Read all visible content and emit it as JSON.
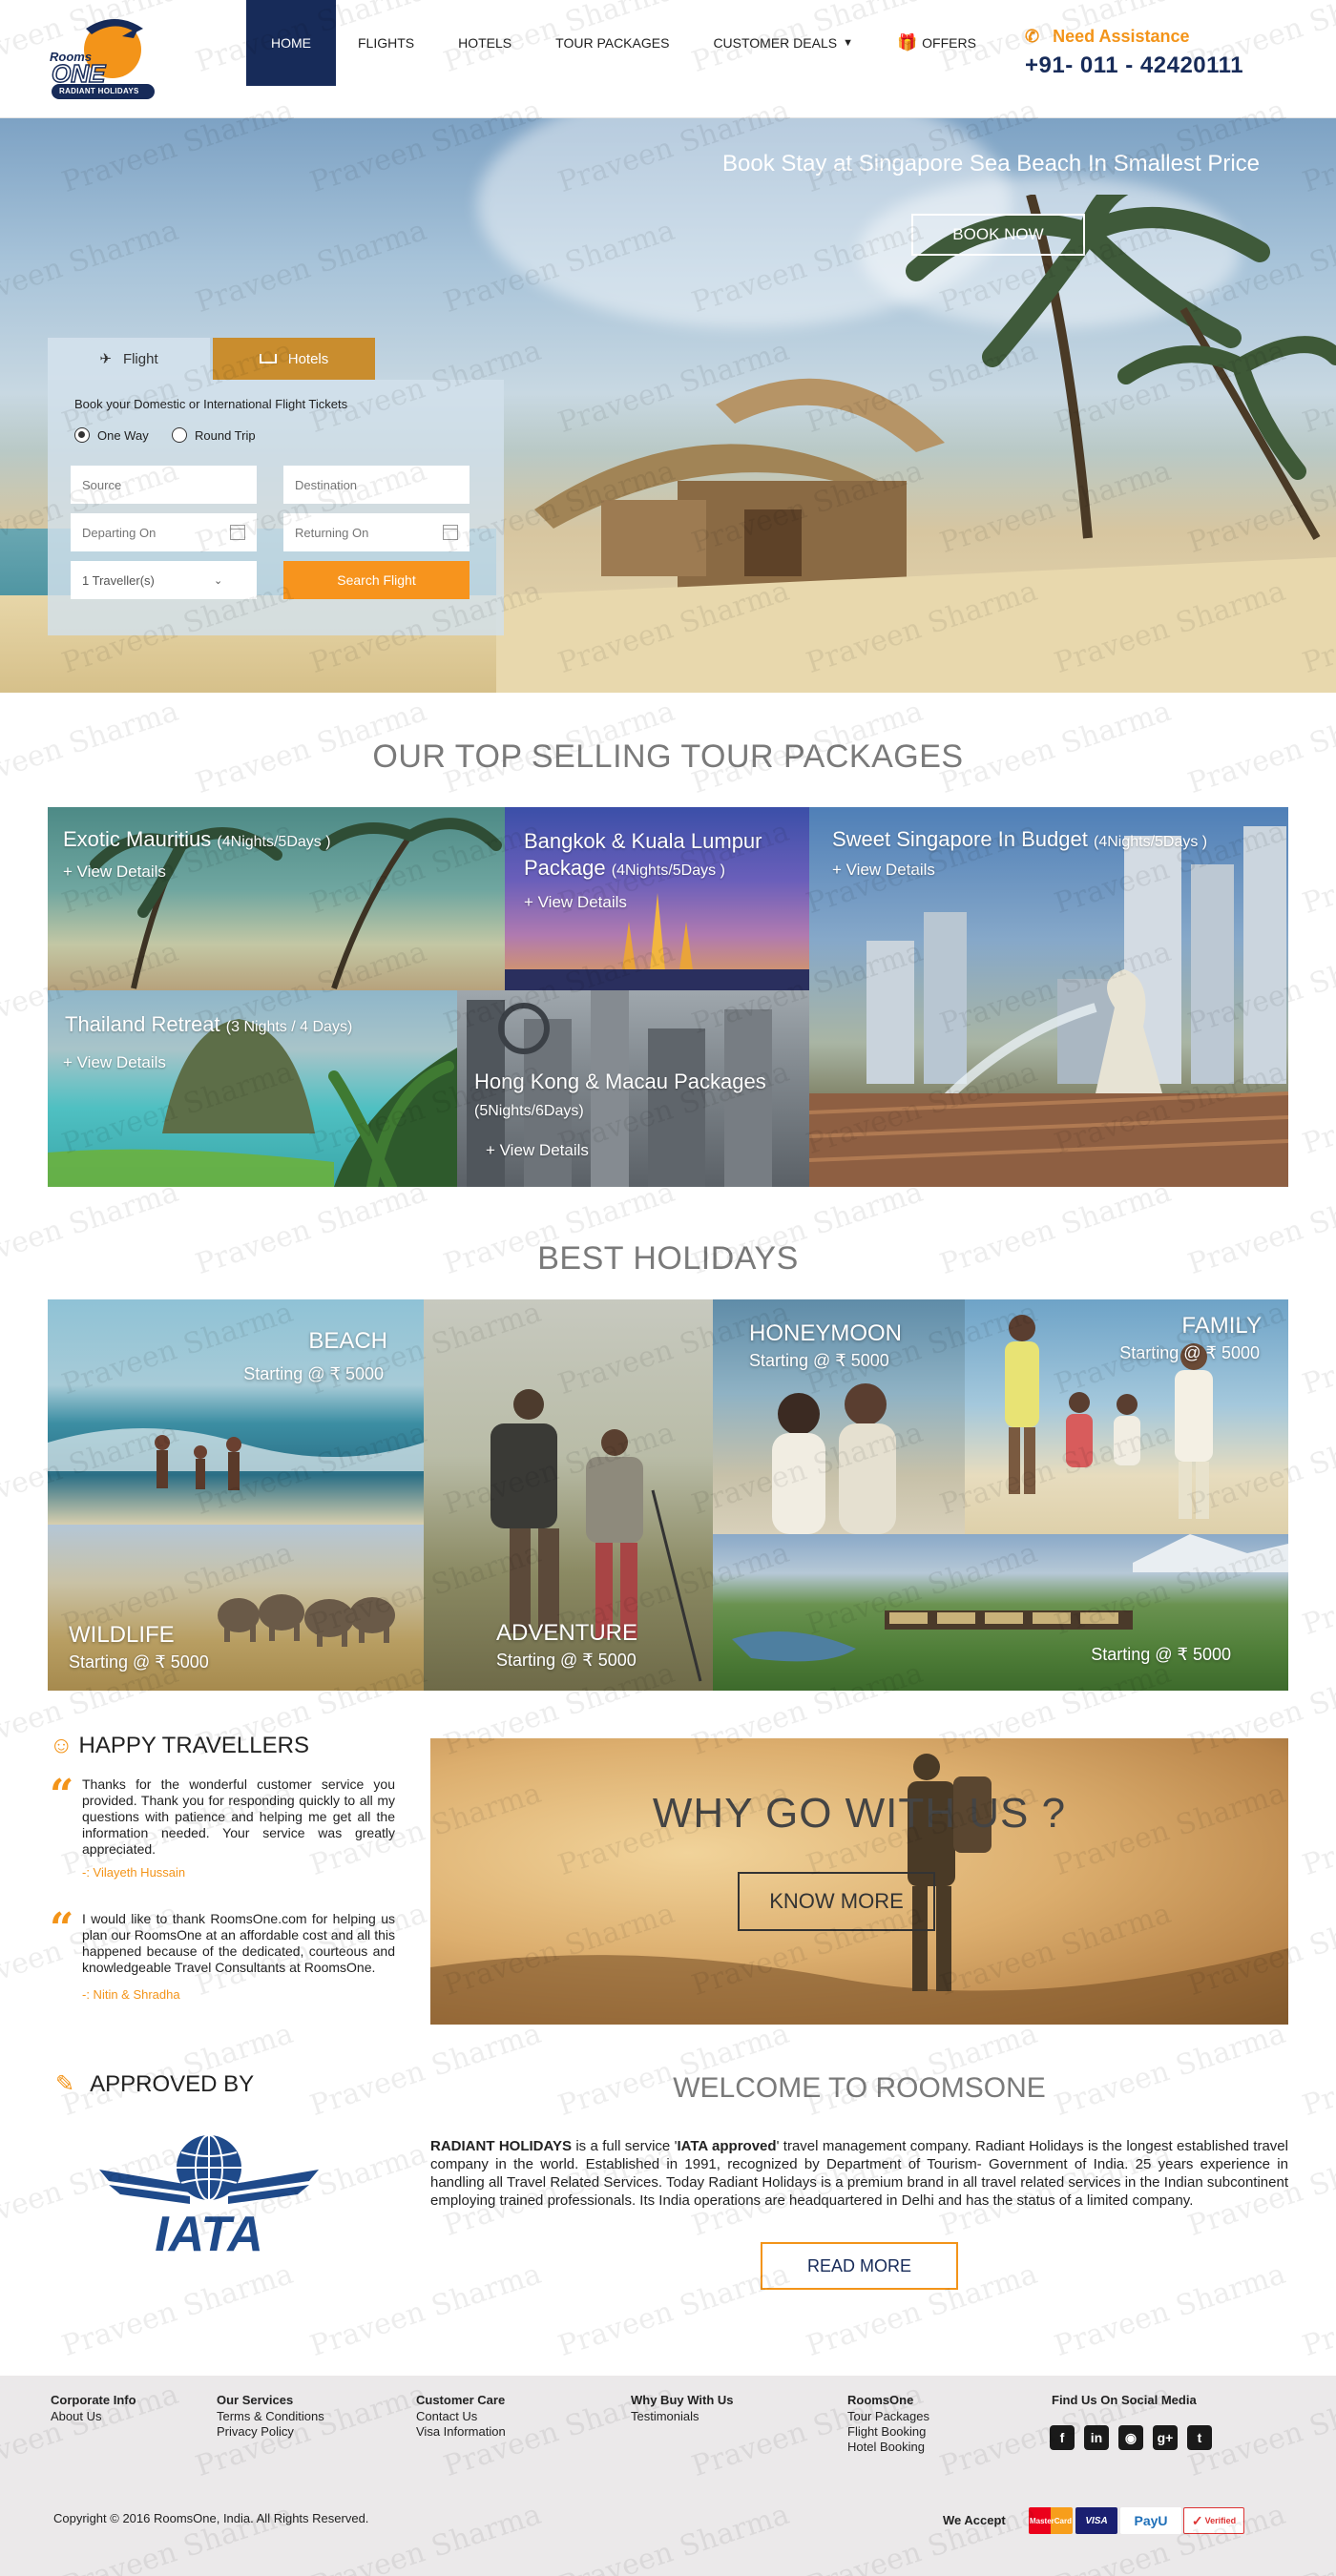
{
  "header": {
    "logo_top": "Rooms",
    "logo_main": "ONE",
    "logo_sub": "RADIANT HOLIDAYS",
    "nav": [
      {
        "label": "HOME",
        "active": true
      },
      {
        "label": "FLIGHTS"
      },
      {
        "label": "HOTELS"
      },
      {
        "label": "TOUR PACKAGES"
      },
      {
        "label": "CUSTOMER DEALS"
      },
      {
        "label": "OFFERS"
      }
    ],
    "assist_label": "Need Assistance",
    "assist_phone": "+91- 011 - 42420111"
  },
  "hero": {
    "headline": "Book  Stay at Singapore Sea Beach In Smallest Price",
    "cta": "BOOK NOW"
  },
  "search": {
    "tabs": [
      "Flight",
      "Hotels"
    ],
    "description": "Book your Domestic or International Flight Tickets",
    "trip_types": [
      "One Way",
      "Round Trip"
    ],
    "selected_trip": "One Way",
    "source_placeholder": "Source",
    "destination_placeholder": "Destination",
    "depart_placeholder": "Departing On",
    "return_placeholder": "Returning On",
    "travellers": "1 Traveller(s)",
    "submit": "Search Flight"
  },
  "tours": {
    "title": "OUR TOP SELLING TOUR PACKAGES",
    "items": [
      {
        "name": "Exotic Mauritius",
        "duration": "(4Nights/5Days )",
        "link": "+ View Details"
      },
      {
        "name": "Bangkok & Kuala Lumpur Package",
        "duration": "(4Nights/5Days )",
        "link": "+ View Details"
      },
      {
        "name": "Sweet Singapore In Budget",
        "duration": "(4Nights/5Days )",
        "link": "+ View Details"
      },
      {
        "name": "Thailand Retreat",
        "duration": "(3 Nights / 4 Days)",
        "link": "+ View Details"
      },
      {
        "name": "Hong Kong & Macau Packages",
        "duration": "(5Nights/6Days)",
        "link": "+ View Details"
      }
    ]
  },
  "holidays": {
    "title": "BEST  HOLIDAYS",
    "items": [
      {
        "name": "BEACH",
        "price": "Starting @ ₹ 5000"
      },
      {
        "name": "HONEYMOON",
        "price": "Starting @ ₹ 5000"
      },
      {
        "name": "FAMILY",
        "price": "Starting @ ₹ 5000"
      },
      {
        "name": "WILDLIFE",
        "price": "Starting @ ₹ 5000"
      },
      {
        "name": "ADVENTURE",
        "price": "Starting @ ₹ 5000"
      },
      {
        "name": "",
        "price": "Starting @ ₹ 5000"
      }
    ]
  },
  "testimonials": {
    "title": "HAPPY TRAVELLERS",
    "items": [
      {
        "text": "Thanks for the wonderful customer service you provided. Thank you for responding quickly to all my questions with patience and helping me get all the information needed. Your service was greatly appreciated.",
        "author": "-: Vilayeth Hussain"
      },
      {
        "text": "I would like to thank RoomsOne.com for helping us plan our RoomsOne at an affordable cost and all this happened because of the dedicated, courteous and knowledgeable Travel Consultants at RoomsOne.",
        "author": "-: Nitin & Shradha"
      }
    ]
  },
  "why": {
    "title": "WHY GO WITH US ?",
    "cta": "KNOW MORE"
  },
  "approved": {
    "title": "APPROVED BY",
    "logo_text": "IATA"
  },
  "welcome": {
    "title": "WELCOME TO ROOMSONE",
    "company": "RADIANT HOLIDAYS",
    "text_a": " is a full service '",
    "iata": "IATA approved",
    "text_b": "' travel management company. Radiant Holidays is the longest established travel company in the world. Established in 1991, recognized by Department of Tourism- Government of India. 25 years experience in handling all Travel Related Services. Today Radiant Holidays is a premium brand in all travel related services in the Indian subcontinent employing trained professionals. Its India operations are headquartered in Delhi and has the status of a limited company.",
    "cta": "READ MORE"
  },
  "footer": {
    "columns": [
      {
        "heading": "Corporate Info",
        "links": [
          "About Us"
        ]
      },
      {
        "heading": "Our Services",
        "links": [
          "Terms & Conditions",
          "Privacy Policy"
        ]
      },
      {
        "heading": "Customer Care",
        "links": [
          "Contact Us",
          "Visa Information"
        ]
      },
      {
        "heading": "Why Buy With Us",
        "links": [
          "Testimonials"
        ]
      },
      {
        "heading": "RoomsOne",
        "links": [
          "Tour Packages",
          "Flight Booking",
          "Hotel Booking"
        ]
      }
    ],
    "social_title": "Find Us On Social Media",
    "social": [
      "facebook-icon",
      "linkedin-icon",
      "instagram-icon",
      "google-plus-icon",
      "twitter-icon"
    ],
    "copyright": "Copyright © 2016 RoomsOne, India. All Rights Reserved.",
    "we_accept": "We Accept",
    "payments": [
      "MasterCard",
      "VISA",
      "PayU",
      "Verified"
    ]
  },
  "watermark": "Praveen Sharma",
  "colors": {
    "navy": "#172b59",
    "orange": "#f39419",
    "btn_orange": "#f7941d"
  }
}
